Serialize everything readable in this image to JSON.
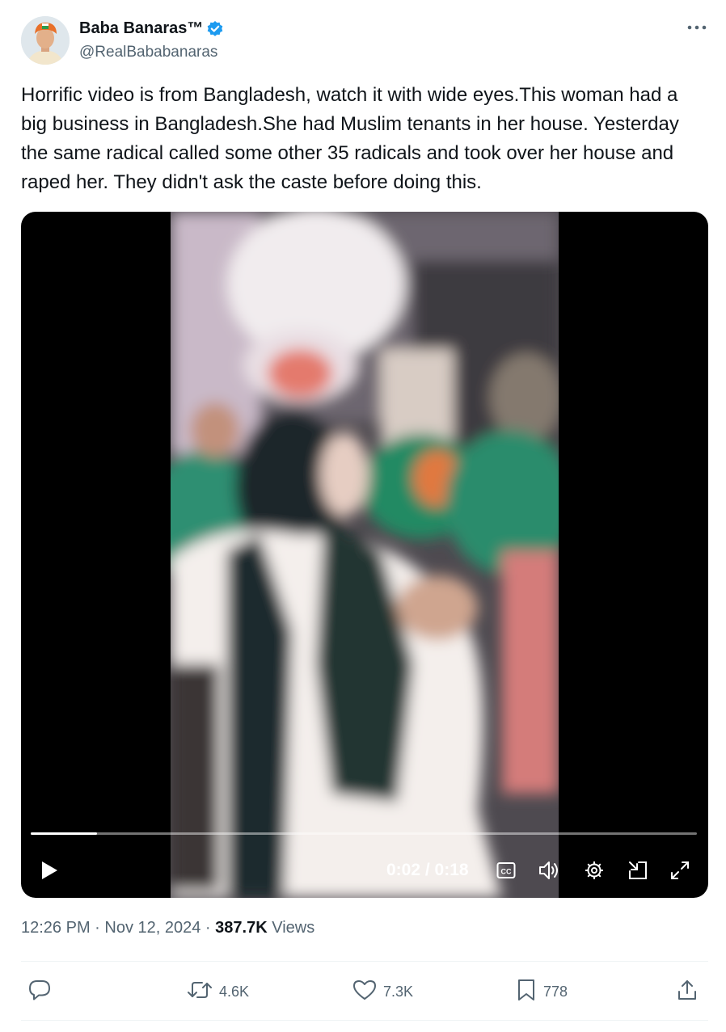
{
  "author": {
    "display_name": "Baba Banaras™",
    "handle": "@RealBababanaras",
    "verified": true
  },
  "tweet": {
    "text": "Horrific video is from Bangladesh, watch it with wide eyes.This woman had a big business in Bangladesh.She had Muslim tenants in her house. Yesterday the same radical called some other 35 radicals and took over her house and raped her. They didn't ask the caste before doing this.",
    "time": "12:26 PM",
    "separator1": " · ",
    "date": "Nov 12, 2024",
    "separator2": " · ",
    "views_count": "387.7K",
    "views_label": " Views"
  },
  "video": {
    "current_time": "0:02",
    "time_sep": " / ",
    "duration": "0:18",
    "progress_fraction": 0.1
  },
  "actions": {
    "reply_count": "",
    "retweet_count": "4.6K",
    "like_count": "7.3K",
    "bookmark_count": "778"
  },
  "colors": {
    "accent": "#1d9bf0",
    "text_primary": "#0f1419",
    "text_secondary": "#536471"
  },
  "icons": [
    "more-icon",
    "verified-badge-icon",
    "play-icon",
    "captions-icon",
    "volume-icon",
    "settings-icon",
    "pip-icon",
    "fullscreen-icon",
    "reply-icon",
    "retweet-icon",
    "like-icon",
    "bookmark-icon",
    "share-icon"
  ]
}
